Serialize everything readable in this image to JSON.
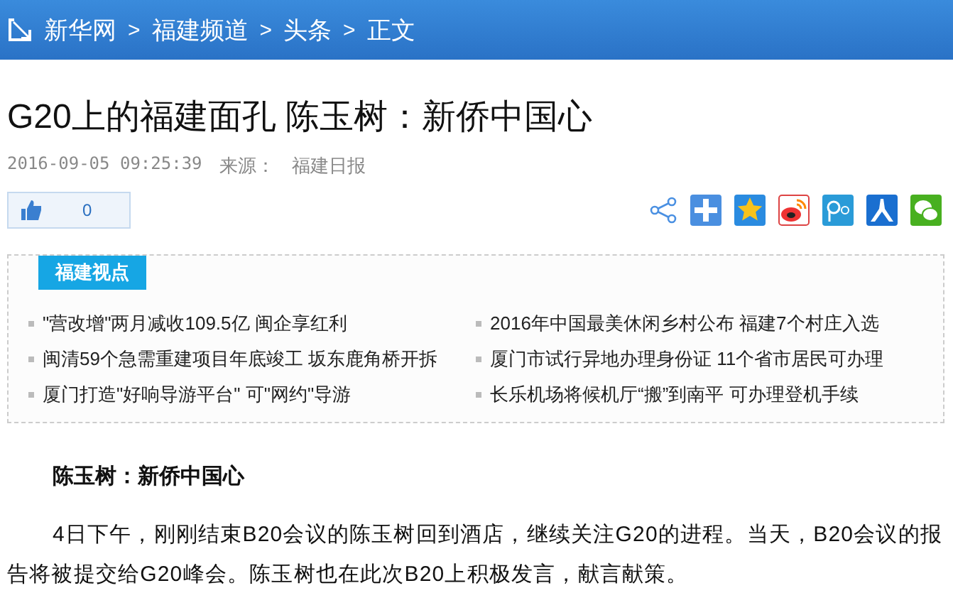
{
  "breadcrumb": [
    "新华网",
    "福建频道",
    "头条",
    "正文"
  ],
  "breadcrumb_separator": ">",
  "title": "G20上的福建面孔 陈玉树：新侨中国心",
  "meta": {
    "datetime": "2016-09-05 09:25:39",
    "source_label": "来源：",
    "source": "福建日报"
  },
  "like": {
    "count": "0"
  },
  "related": {
    "tag": "福建视点",
    "items": [
      {
        "text": "\"营改增\"两月减收109.5亿 闽企享红利"
      },
      {
        "text": "2016年中国最美休闲乡村公布 福建7个村庄入选"
      },
      {
        "text": "闽清59个急需重建项目年底竣工 坂东鹿角桥开拆"
      },
      {
        "text": "厦门市试行异地办理身份证 11个省市居民可办理"
      },
      {
        "text": "厦门打造\"好响导游平台\" 可\"网约\"导游"
      },
      {
        "text": "长乐机场将候机厅“搬”到南平 可办理登机手续"
      }
    ]
  },
  "article": {
    "heading": "陈玉树：新侨中国心",
    "paragraphs": [
      "4日下午，刚刚结束B20会议的陈玉树回到酒店，继续关注G20的进程。当天，B20会议的报告将被提交给G20峰会。陈玉树也在此次B20上积极发言，献言献策。"
    ]
  }
}
